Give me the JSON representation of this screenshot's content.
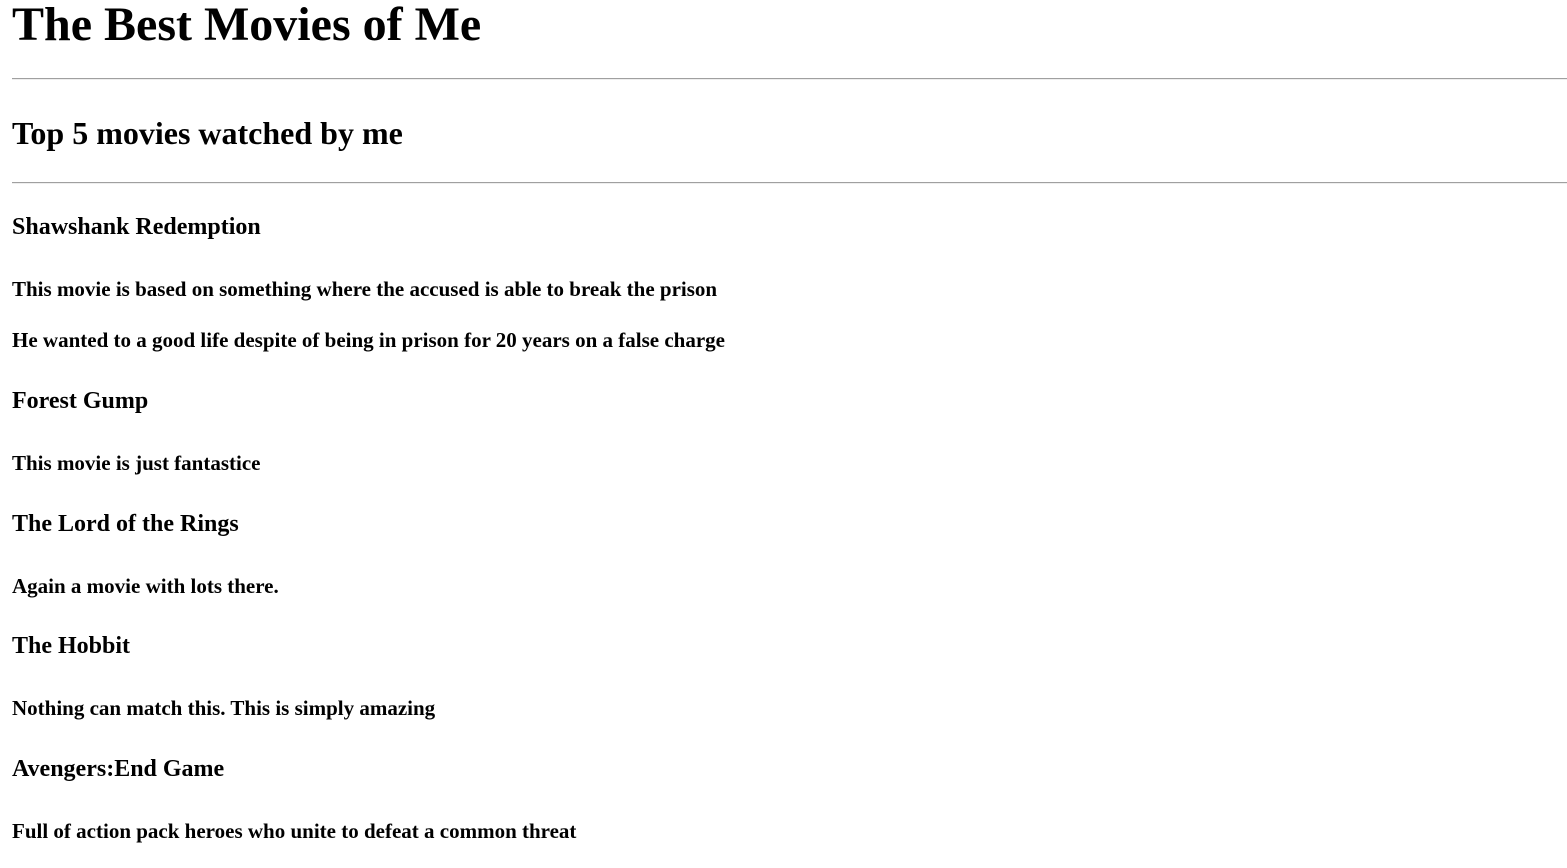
{
  "page": {
    "title": "The Best Movies of Me",
    "subtitle": "Top 5 movies watched by me"
  },
  "movies": [
    {
      "title": "Shawshank Redemption",
      "descriptions": [
        "This movie is based on something where the accused is able to break the prison",
        "He wanted to a good life despite of being in prison for 20 years on a false charge"
      ]
    },
    {
      "title": "Forest Gump",
      "descriptions": [
        "This movie is just fantastice"
      ]
    },
    {
      "title": "The Lord of the Rings",
      "descriptions": [
        "Again a movie with lots there."
      ]
    },
    {
      "title": "The Hobbit",
      "descriptions": [
        "Nothing can match this. This is simply amazing"
      ]
    },
    {
      "title": "Avengers:End Game",
      "descriptions": [
        "Full of action pack heroes who unite to defeat a common threat"
      ]
    }
  ]
}
